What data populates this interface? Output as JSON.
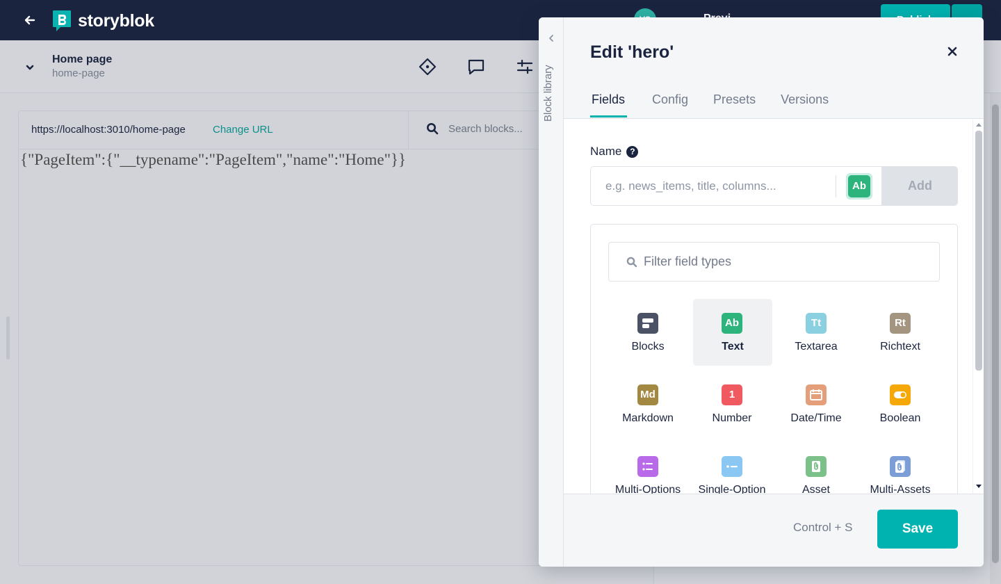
{
  "topbar": {
    "brand": "storyblok",
    "avatar_initials": "VS",
    "ghost_text": "Previ",
    "publish_label": "Publish"
  },
  "story": {
    "title": "Home page",
    "slug": "home-page"
  },
  "preview": {
    "url": "https://localhost:3010/home-page",
    "change_url_label": "Change URL",
    "search_placeholder": "Search blocks...",
    "json_text": "{\"PageItem\":{\"__typename\":\"PageItem\",\"name\":\"Home\"}}"
  },
  "panel": {
    "library_label": "Block library",
    "title": "Edit 'hero'",
    "tabs": [
      {
        "label": "Fields",
        "active": true
      },
      {
        "label": "Config",
        "active": false
      },
      {
        "label": "Presets",
        "active": false
      },
      {
        "label": "Versions",
        "active": false
      }
    ],
    "name_label": "Name",
    "help_glyph": "?",
    "name_placeholder": "e.g. news_items, title, columns...",
    "name_type_badge": "Ab",
    "add_label": "Add",
    "filter_placeholder": "Filter field types",
    "field_types": [
      {
        "label": "Blocks",
        "icon": "",
        "icon_name": "blocks-icon",
        "color": "#4b5266"
      },
      {
        "label": "Text",
        "icon": "Ab",
        "icon_name": "text-icon",
        "color": "#2db47d",
        "selected": true
      },
      {
        "label": "Textarea",
        "icon": "Tt",
        "icon_name": "textarea-icon",
        "color": "#8bd0e0"
      },
      {
        "label": "Richtext",
        "icon": "Rt",
        "icon_name": "richtext-icon",
        "color": "#a49581"
      },
      {
        "label": "Markdown",
        "icon": "Md",
        "icon_name": "markdown-icon",
        "color": "#a38842"
      },
      {
        "label": "Number",
        "icon": "1",
        "icon_name": "number-icon",
        "color": "#f0595f"
      },
      {
        "label": "Date/Time",
        "icon": "",
        "icon_name": "calendar-icon",
        "color": "#e49f7a"
      },
      {
        "label": "Boolean",
        "icon": "",
        "icon_name": "toggle-icon",
        "color": "#f6a807"
      },
      {
        "label": "Multi-Options",
        "icon": "",
        "icon_name": "list-icon",
        "color": "#b96ae8"
      },
      {
        "label": "Single-Option",
        "icon": "",
        "icon_name": "option-icon",
        "color": "#8ac7f2"
      },
      {
        "label": "Asset",
        "icon": "",
        "icon_name": "asset-icon",
        "color": "#7cc08a"
      },
      {
        "label": "Multi-Assets",
        "icon": "",
        "icon_name": "multi-assets-icon",
        "color": "#7c9ed6"
      }
    ],
    "shortcut_hint": "Control + S",
    "save_label": "Save"
  },
  "colors": {
    "navy": "#1b243f",
    "teal": "#00b3b0",
    "overlay": "#d1d3d8"
  }
}
